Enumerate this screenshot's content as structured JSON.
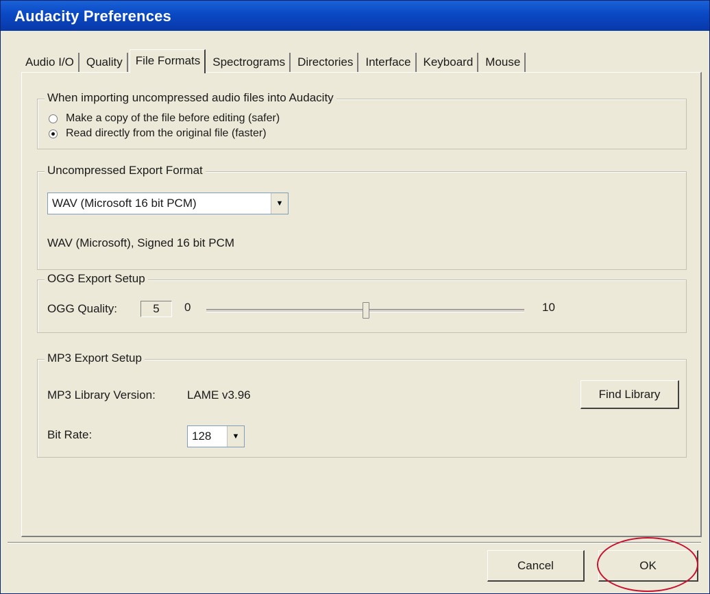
{
  "window": {
    "title": "Audacity Preferences",
    "accent_color": "#0a48c4"
  },
  "tabs": [
    {
      "label": "Audio I/O",
      "active": false
    },
    {
      "label": "Quality",
      "active": false
    },
    {
      "label": "File Formats",
      "active": true
    },
    {
      "label": "Spectrograms",
      "active": false
    },
    {
      "label": "Directories",
      "active": false
    },
    {
      "label": "Interface",
      "active": false
    },
    {
      "label": "Keyboard",
      "active": false
    },
    {
      "label": "Mouse",
      "active": false
    }
  ],
  "import_group": {
    "legend": "When importing uncompressed audio files into Audacity",
    "options": [
      {
        "label": "Make a copy of the file before editing (safer)",
        "checked": false
      },
      {
        "label": "Read directly from the original file (faster)",
        "checked": true
      }
    ]
  },
  "export_format_group": {
    "legend": "Uncompressed Export Format",
    "selected_format": "WAV (Microsoft 16 bit PCM)",
    "description": "WAV (Microsoft), Signed 16 bit PCM"
  },
  "ogg_group": {
    "legend": "OGG Export Setup",
    "quality_label": "OGG Quality:",
    "quality_value": "5",
    "slider_min": "0",
    "slider_max": "10",
    "slider_fraction": 0.5
  },
  "mp3_group": {
    "legend": "MP3 Export Setup",
    "library_label": "MP3 Library Version:",
    "library_version": "LAME v3.96",
    "find_library_label": "Find Library",
    "bitrate_label": "Bit Rate:",
    "bitrate_value": "128"
  },
  "footer": {
    "cancel_label": "Cancel",
    "ok_label": "OK",
    "highlight_color": "#c8102e"
  },
  "icons": {
    "dropdown": "chevron-down-icon"
  }
}
